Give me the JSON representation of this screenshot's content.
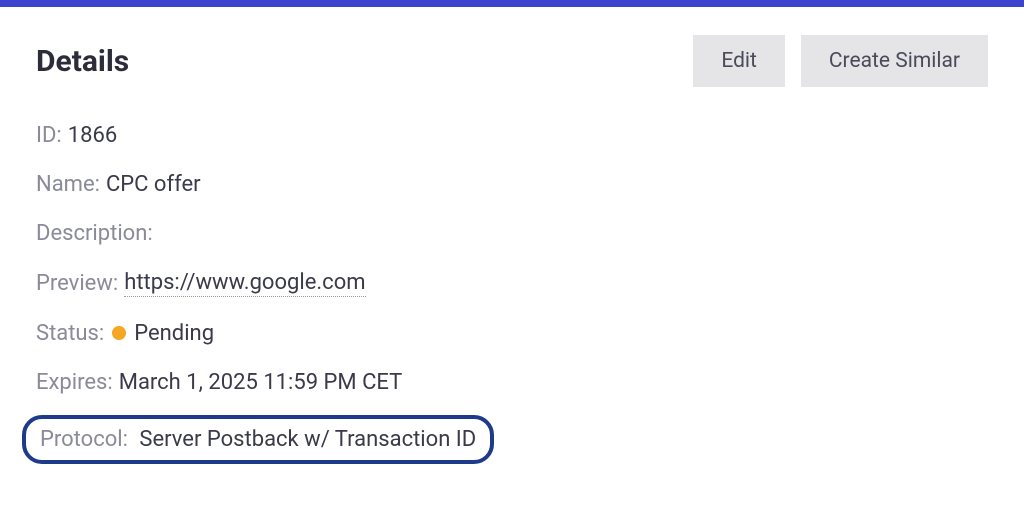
{
  "header": {
    "title": "Details",
    "edit_label": "Edit",
    "create_similar_label": "Create Similar"
  },
  "details": {
    "id_label": "ID:",
    "id_value": "1866",
    "name_label": "Name:",
    "name_value": "CPC offer",
    "description_label": "Description:",
    "description_value": "",
    "preview_label": "Preview:",
    "preview_value": "https://www.google.com",
    "status_label": "Status:",
    "status_value": "Pending",
    "status_color": "#f5a623",
    "expires_label": "Expires:",
    "expires_value": "March 1, 2025 11:59 PM CET",
    "protocol_label": "Protocol:",
    "protocol_value": "Server Postback w/ Transaction ID"
  }
}
